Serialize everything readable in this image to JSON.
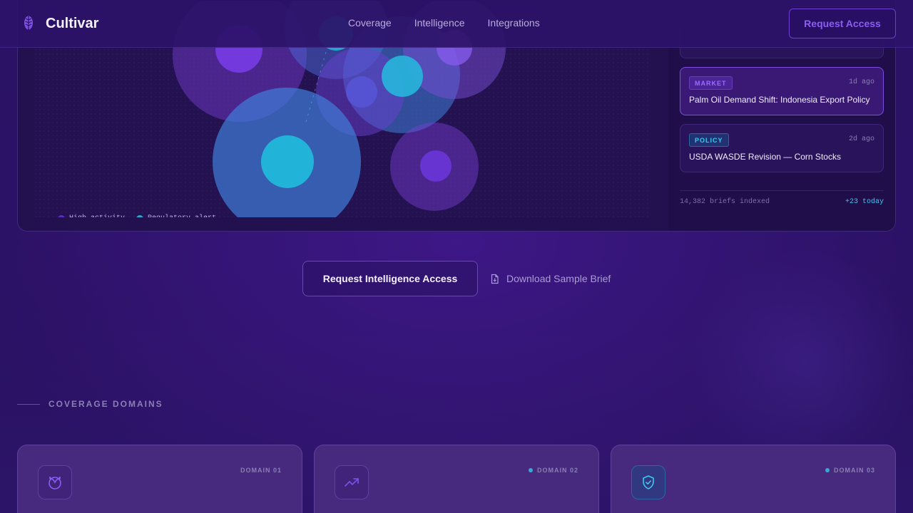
{
  "brand": {
    "name": "Cultivar",
    "logo_icon": "seed-icon"
  },
  "nav": {
    "items": [
      {
        "label": "Coverage"
      },
      {
        "label": "Intelligence"
      },
      {
        "label": "Integrations"
      }
    ],
    "cta": "Request Access"
  },
  "map": {
    "legend": [
      {
        "label": "High activity",
        "color": "#5b2fc4"
      },
      {
        "label": "Regulatory alert",
        "color": "#2ea6d3"
      }
    ]
  },
  "feed": {
    "briefs": [
      {
        "tag": "MARKET",
        "ago": "1d ago",
        "headline": "Palm Oil Demand Shift: Indonesia Export Policy"
      },
      {
        "tag": "POLICY",
        "ago": "2d ago",
        "headline": "USDA WASDE Revision — Corn Stocks"
      }
    ],
    "indexed": "14,382 briefs indexed",
    "today": "+23 today"
  },
  "cta": {
    "primary": "Request Intelligence Access",
    "secondary": "Download Sample Brief"
  },
  "coverage": {
    "label": "COVERAGE DOMAINS",
    "domains": [
      {
        "label": "DOMAIN 01",
        "icon": "sprout-icon"
      },
      {
        "label": "DOMAIN 02",
        "icon": "trend-up-icon"
      },
      {
        "label": "DOMAIN 03",
        "icon": "shield-check-icon"
      }
    ]
  },
  "colors": {
    "background": "#2a1263",
    "accent": "#8b5cf6",
    "teal": "#3ec6f0"
  }
}
